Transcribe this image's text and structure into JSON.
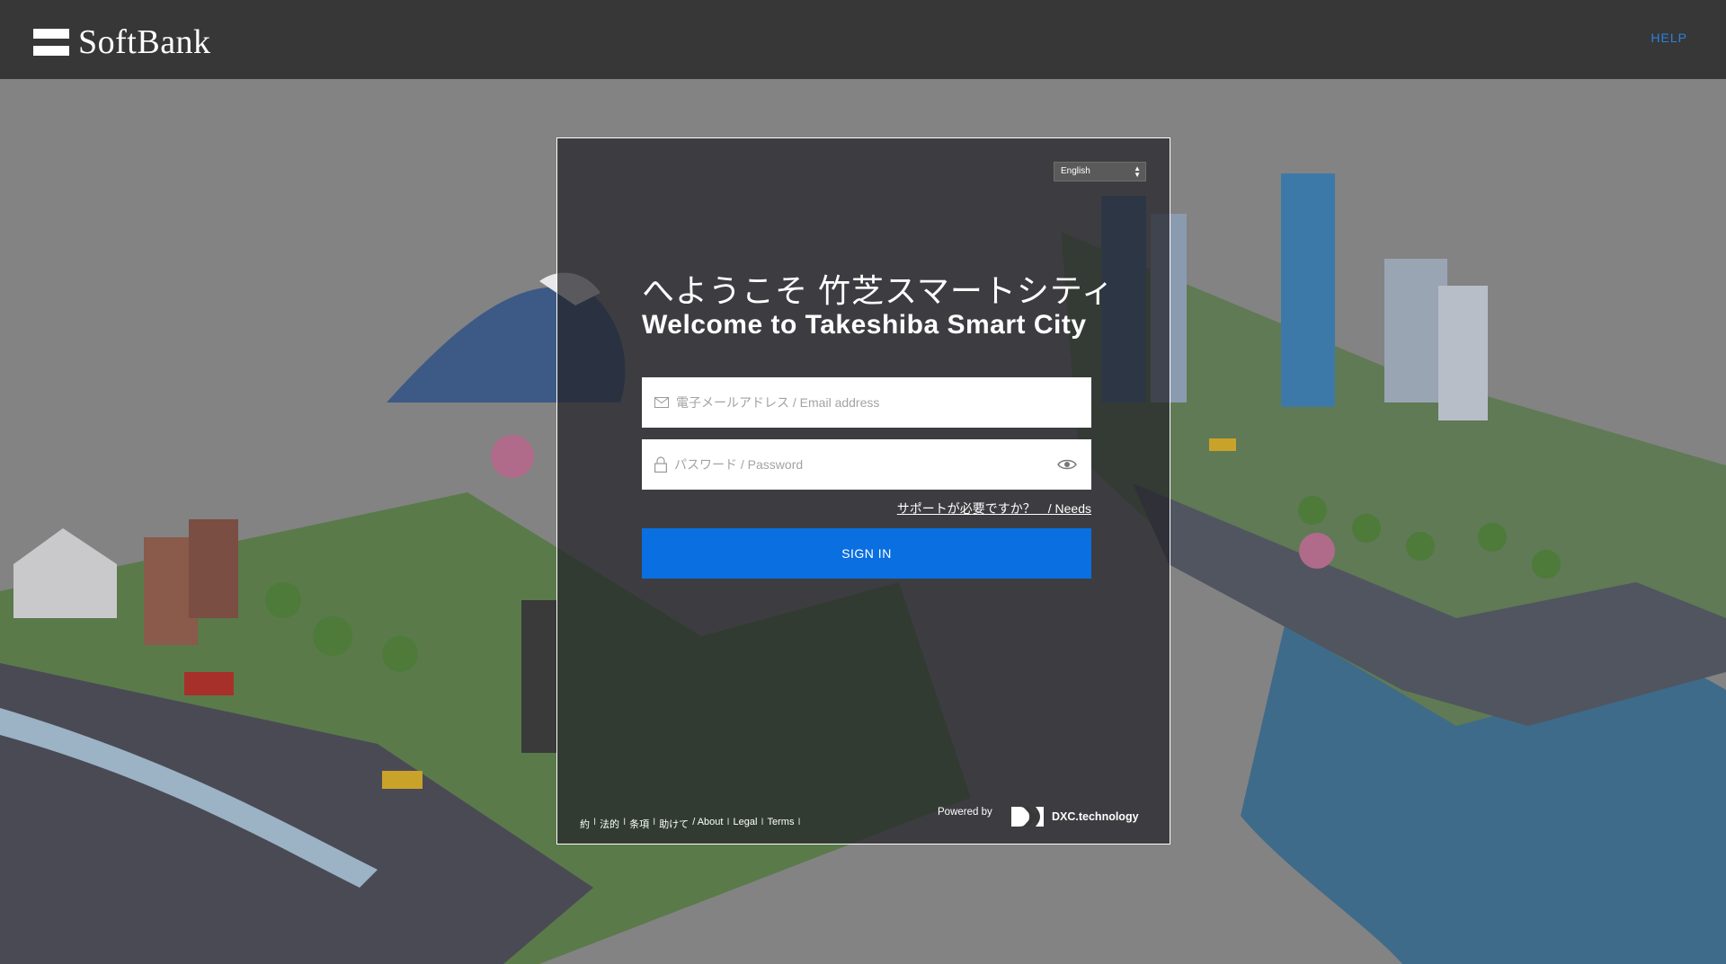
{
  "header": {
    "logo_text": "SoftBank",
    "help_label": "HELP"
  },
  "login": {
    "language": "English",
    "title_jp": "へようこそ 竹芝スマートシティ",
    "title_en": "Welcome to Takeshiba Smart City",
    "email_placeholder": "電子メールアドレス / Email address",
    "password_placeholder": "パスワード / Password",
    "support_text": "サポートが必要ですか？　/ Needs",
    "signin_label": "SIGN IN",
    "footer_links": [
      "約",
      "法的",
      "条項",
      "助けて",
      "/ About",
      "Legal",
      "Terms"
    ],
    "powered_by": "Powered by",
    "brand": "DXC.technology"
  },
  "colors": {
    "header_bg": "#373737",
    "accent": "#0a6fe0",
    "help_link": "#2a82da"
  }
}
